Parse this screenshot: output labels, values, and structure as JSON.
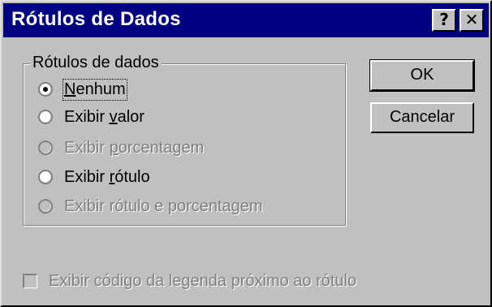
{
  "window": {
    "title": "Rótulos de Dados",
    "help_label": "?",
    "close_label": "✕"
  },
  "group": {
    "label": "Rótulos de dados",
    "options": [
      {
        "pre": "",
        "key": "N",
        "post": "enhum",
        "checked": true,
        "enabled": true
      },
      {
        "pre": "Exibir ",
        "key": "v",
        "post": "alor",
        "checked": false,
        "enabled": true
      },
      {
        "pre": "Exibir ",
        "key": "p",
        "post": "orcentagem",
        "checked": false,
        "enabled": false
      },
      {
        "pre": "Exibir ",
        "key": "r",
        "post": "ótulo",
        "checked": false,
        "enabled": true
      },
      {
        "pre": "Exibir rótulo e porcentagem",
        "key": "",
        "post": "",
        "checked": false,
        "enabled": false
      }
    ]
  },
  "buttons": {
    "ok_label": "OK",
    "cancel_label": "Cancelar"
  },
  "legend_checkbox": {
    "label": "Exibir código da legenda próximo ao rótulo",
    "checked": false,
    "enabled": false
  }
}
